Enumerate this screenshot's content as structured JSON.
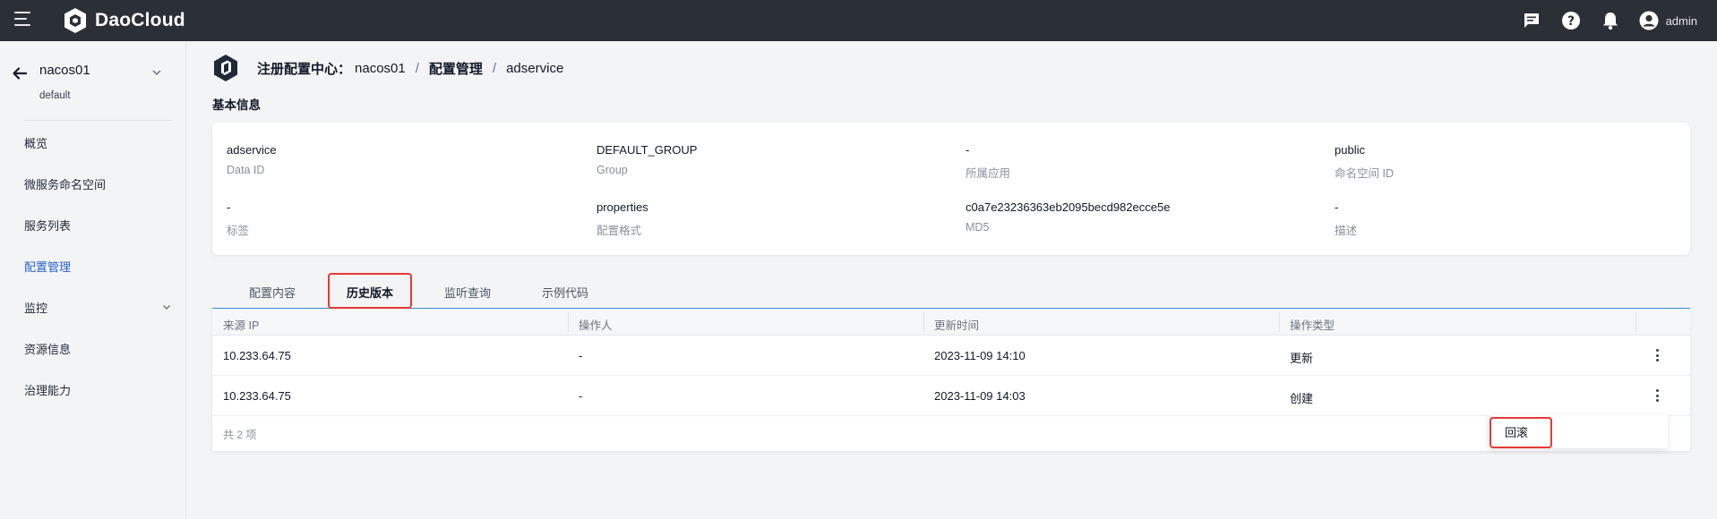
{
  "header": {
    "brand": "DaoCloud",
    "user_name": "admin",
    "icons": [
      "menu-icon",
      "message-icon",
      "help-icon",
      "bell-icon",
      "user-avatar-icon"
    ]
  },
  "sidebar": {
    "cluster_name": "nacos01",
    "cluster_namespace": "default",
    "items": [
      {
        "label": "概览"
      },
      {
        "label": "微服务命名空间"
      },
      {
        "label": "服务列表"
      },
      {
        "label": "配置管理",
        "active": true
      },
      {
        "label": "监控"
      },
      {
        "label": "资源信息"
      },
      {
        "label": "治理能力"
      }
    ]
  },
  "breadcrumb": {
    "root": "注册配置中心：",
    "instance": "nacos01",
    "section": "配置管理",
    "current": "adservice",
    "separator": "/"
  },
  "basic_info": {
    "title": "基本信息",
    "fields": [
      {
        "value": "adservice",
        "label": "Data ID"
      },
      {
        "value": "DEFAULT_GROUP",
        "label": "Group"
      },
      {
        "value": "-",
        "label": "所属应用"
      },
      {
        "value": "public",
        "label": "命名空间 ID"
      },
      {
        "value": "-",
        "label": "标签"
      },
      {
        "value": "properties",
        "label": "配置格式"
      },
      {
        "value": "c0a7e23236363eb2095becd982ecce5e",
        "label": "MD5"
      },
      {
        "value": "-",
        "label": "描述"
      }
    ]
  },
  "tabs": [
    {
      "label": "配置内容"
    },
    {
      "label": "历史版本",
      "active": true
    },
    {
      "label": "监听查询"
    },
    {
      "label": "示例代码"
    }
  ],
  "table": {
    "columns": [
      "来源 IP",
      "操作人",
      "更新时间",
      "操作类型"
    ],
    "rows": [
      {
        "ip": "10.233.64.75",
        "operator": "-",
        "time": "2023-11-09 14:10",
        "type": "更新"
      },
      {
        "ip": "10.233.64.75",
        "operator": "-",
        "time": "2023-11-09 14:03",
        "type": "创建"
      }
    ],
    "total": "共 2 项"
  },
  "menu": {
    "rollback": "回滚"
  },
  "colors": {
    "topbar": "#2b2f36",
    "accent": "#2563c9",
    "highlight": "#e53935"
  }
}
